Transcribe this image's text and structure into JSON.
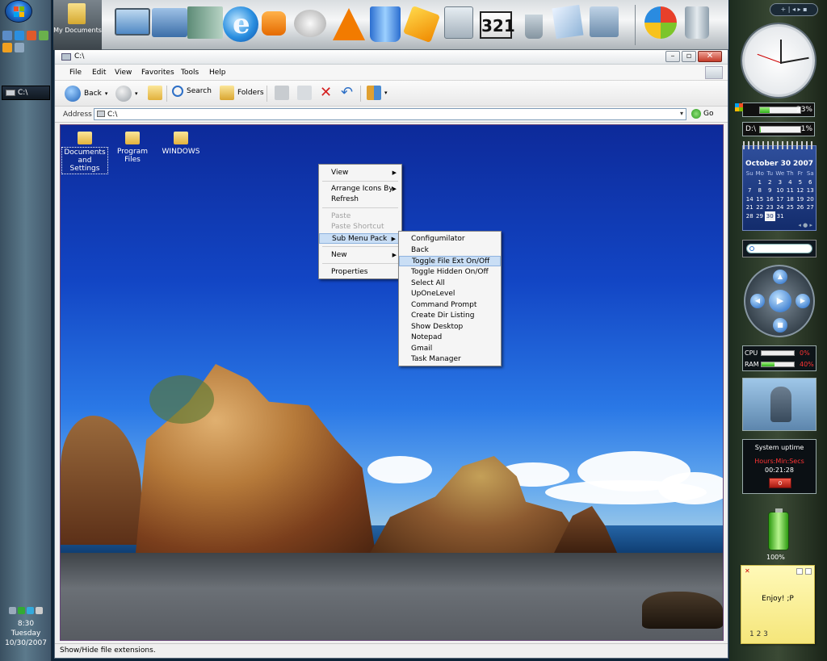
{
  "taskbar": {
    "task_label": "C:\\",
    "clock_time": "8:30",
    "clock_day": "Tuesday",
    "clock_date": "10/30/2007"
  },
  "dock": {
    "my_documents_label": "My Documents",
    "icons": [
      "computer-icon",
      "network-icon",
      "notebook-icon",
      "internet-explorer-icon",
      "media-player-icon",
      "mask-icon",
      "vlc-cone-icon",
      "recycle-bin-icon",
      "bolt-icon",
      "calculator-icon",
      "clapper-321-icon",
      "pens-icon",
      "notepad-icon",
      "control-panel-icon",
      "windows-logo-icon",
      "trash-icon"
    ],
    "clapper_text": "321"
  },
  "window": {
    "title": "C:\\",
    "menu": [
      "File",
      "Edit",
      "View",
      "Favorites",
      "Tools",
      "Help"
    ],
    "toolbar": {
      "back_label": "Back",
      "search_label": "Search",
      "folders_label": "Folders"
    },
    "address": {
      "label": "Address",
      "value": "C:\\",
      "go_label": "Go"
    },
    "status": "Show/Hide file extensions."
  },
  "desktop": {
    "icons": [
      {
        "label": "Documents and Settings",
        "selected": true
      },
      {
        "label": "Program Files",
        "selected": false
      },
      {
        "label": "WINDOWS",
        "selected": false
      }
    ]
  },
  "context_menu": {
    "items": [
      {
        "label": "View",
        "submenu": true,
        "disabled": false
      },
      {
        "label": "Arrange Icons By",
        "submenu": true,
        "disabled": false
      },
      {
        "label": "Refresh",
        "submenu": false,
        "disabled": false
      },
      {
        "label": "Paste",
        "submenu": false,
        "disabled": true
      },
      {
        "label": "Paste Shortcut",
        "submenu": false,
        "disabled": true
      },
      {
        "label": "Sub Menu Pack",
        "submenu": true,
        "disabled": false,
        "highlighted": true
      },
      {
        "label": "New",
        "submenu": true,
        "disabled": false
      },
      {
        "label": "Properties",
        "submenu": false,
        "disabled": false
      }
    ]
  },
  "sub_menu": {
    "items": [
      {
        "label": "Configumilator",
        "highlighted": false
      },
      {
        "label": "Back",
        "highlighted": false
      },
      {
        "label": "Toggle File Ext On/Off",
        "highlighted": true
      },
      {
        "label": "Toggle Hidden On/Off",
        "highlighted": false
      },
      {
        "label": "Select All",
        "highlighted": false
      },
      {
        "label": "UpOneLevel",
        "highlighted": false
      },
      {
        "label": "Command Prompt",
        "highlighted": false
      },
      {
        "label": "Create Dir Listing",
        "highlighted": false
      },
      {
        "label": "Show Desktop",
        "highlighted": false
      },
      {
        "label": "Notepad",
        "highlighted": false
      },
      {
        "label": "Gmail",
        "highlighted": false
      },
      {
        "label": "Task Manager",
        "highlighted": false
      }
    ]
  },
  "sidebar": {
    "controls": "+ | ◂ ▸ ▪",
    "disk_c": {
      "label": "",
      "percent": "23%",
      "fraction": 0.23
    },
    "disk_d": {
      "label": "D:\\",
      "percent": "1%",
      "fraction": 0.01
    },
    "calendar": {
      "month": "October 30",
      "year": "2007",
      "weekdays": [
        "Su",
        "Mo",
        "Tu",
        "We",
        "Th",
        "Fr",
        "Sa"
      ],
      "weeks": [
        [
          "",
          "1",
          "2",
          "3",
          "4",
          "5",
          "6"
        ],
        [
          "7",
          "8",
          "9",
          "10",
          "11",
          "12",
          "13"
        ],
        [
          "14",
          "15",
          "16",
          "17",
          "18",
          "19",
          "20"
        ],
        [
          "21",
          "22",
          "23",
          "24",
          "25",
          "26",
          "27"
        ],
        [
          "28",
          "29",
          "30",
          "31",
          "",
          "",
          ""
        ]
      ],
      "today": "30"
    },
    "cpu": {
      "label": "CPU",
      "value": "0%",
      "fraction": 0.0
    },
    "ram": {
      "label": "RAM",
      "value": "40%",
      "fraction": 0.4
    },
    "uptime": {
      "title": "System uptime",
      "header": "Hours:Min:Secs",
      "value": "00:21:28",
      "reset_label": "0"
    },
    "battery_percent": "100%",
    "sticky": {
      "text": "Enjoy! ;P",
      "pages": "1 2 3"
    }
  },
  "colors": {
    "menu_highlight": "#c9def5",
    "sky_top": "#0d2a9a",
    "meter_fill": "#2fb21a"
  }
}
